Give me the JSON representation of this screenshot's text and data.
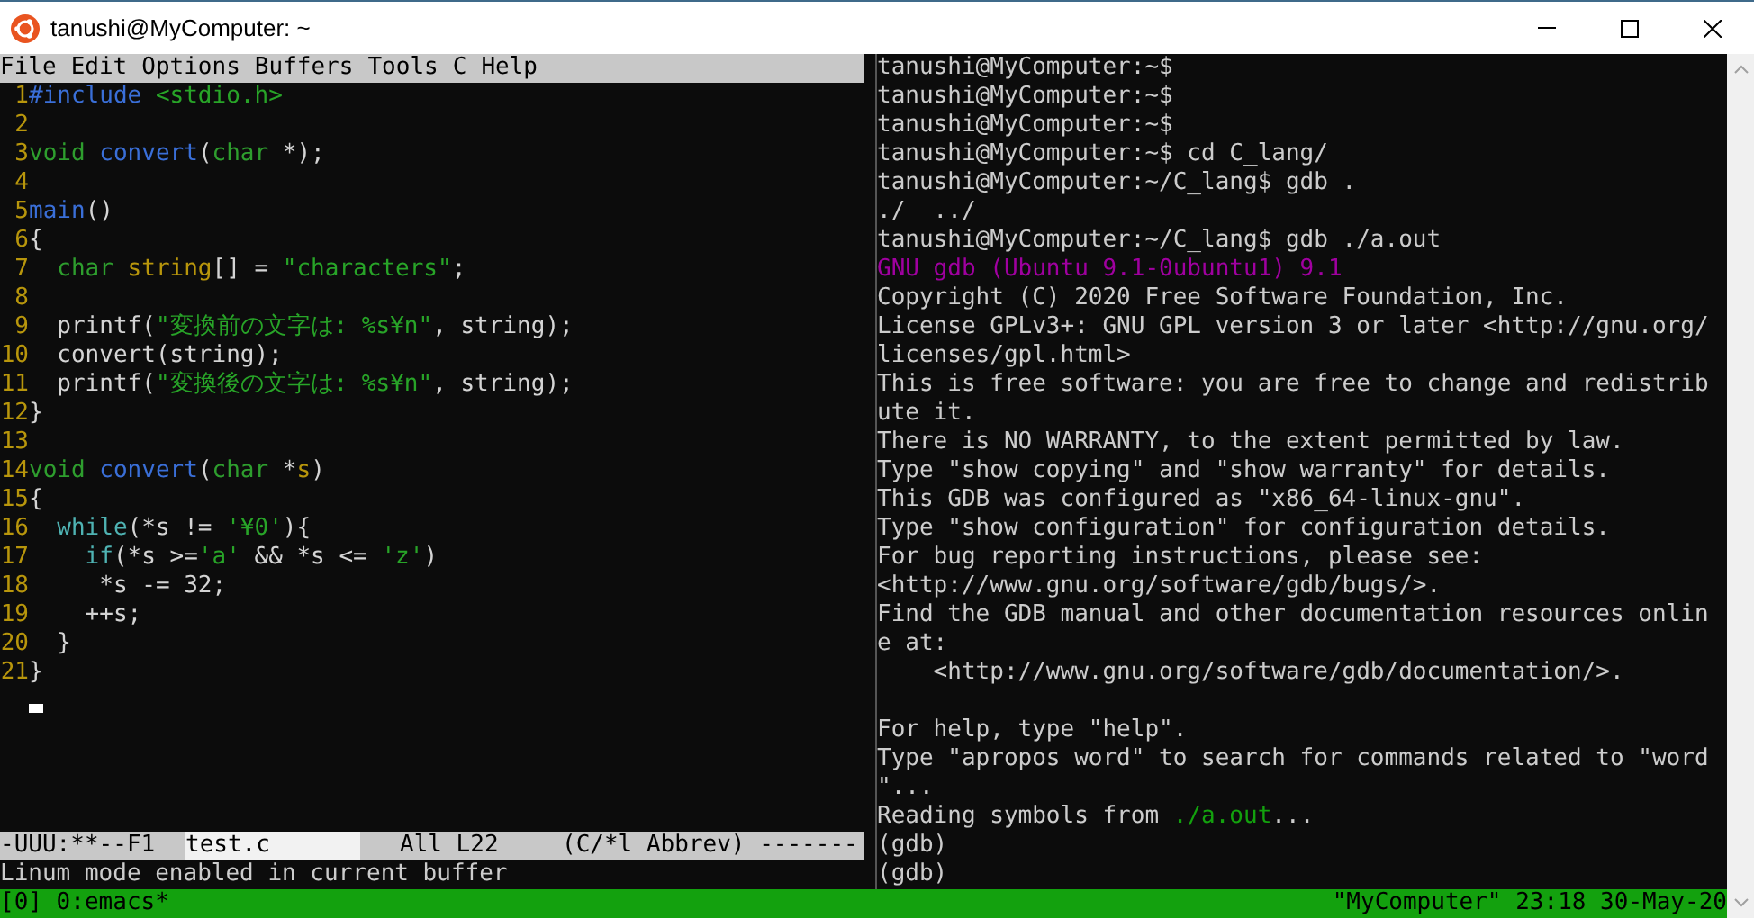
{
  "window": {
    "title": "tanushi@MyComputer: ~"
  },
  "editor": {
    "menu": [
      "File",
      "Edit",
      "Options",
      "Buffers",
      "Tools",
      "C",
      "Help"
    ],
    "lines": [
      {
        "number": "1",
        "segments": [
          {
            "kind": "preprocessor",
            "text": "#include"
          },
          {
            "kind": "string",
            "text": " <stdio.h>"
          }
        ]
      },
      {
        "number": "2"
      },
      {
        "number": "3",
        "segments": [
          {
            "kind": "type",
            "text": "void"
          },
          {
            "kind": "function",
            "text": " convert"
          },
          {
            "kind": "plain",
            "text": "("
          },
          {
            "kind": "type",
            "text": "char"
          },
          {
            "kind": "plain",
            "text": " *);"
          }
        ]
      },
      {
        "number": "4"
      },
      {
        "number": "5",
        "segments": [
          {
            "kind": "function",
            "text": "main"
          },
          {
            "kind": "plain",
            "text": "()"
          }
        ]
      },
      {
        "number": "6",
        "segments": [
          {
            "kind": "plain",
            "text": "{"
          }
        ]
      },
      {
        "number": "7",
        "segments": [
          {
            "kind": "type",
            "text": "  char"
          },
          {
            "kind": "variable",
            "text": " string"
          },
          {
            "kind": "plain",
            "text": "[] = "
          },
          {
            "kind": "string",
            "text": "\"characters\""
          },
          {
            "kind": "plain",
            "text": ";"
          }
        ]
      },
      {
        "number": "8"
      },
      {
        "number": "9",
        "segments": [
          {
            "kind": "plain",
            "text": "  printf("
          },
          {
            "kind": "string",
            "text": "\"変換前の文字は: %s¥n\""
          },
          {
            "kind": "plain",
            "text": ", string);"
          }
        ]
      },
      {
        "number": "10",
        "segments": [
          {
            "kind": "plain",
            "text": "  convert(string);"
          }
        ]
      },
      {
        "number": "11",
        "segments": [
          {
            "kind": "plain",
            "text": "  printf("
          },
          {
            "kind": "string",
            "text": "\"変換後の文字は: %s¥n\""
          },
          {
            "kind": "plain",
            "text": ", string);"
          }
        ]
      },
      {
        "number": "12",
        "segments": [
          {
            "kind": "plain",
            "text": "}"
          }
        ]
      },
      {
        "number": "13"
      },
      {
        "number": "14",
        "segments": [
          {
            "kind": "type",
            "text": "void"
          },
          {
            "kind": "function",
            "text": " convert"
          },
          {
            "kind": "plain",
            "text": "("
          },
          {
            "kind": "type",
            "text": "char"
          },
          {
            "kind": "plain",
            "text": " *"
          },
          {
            "kind": "variable",
            "text": "s"
          },
          {
            "kind": "plain",
            "text": ")"
          }
        ]
      },
      {
        "number": "15",
        "segments": [
          {
            "kind": "plain",
            "text": "{"
          }
        ]
      },
      {
        "number": "16",
        "segments": [
          {
            "kind": "keyword",
            "text": "  while"
          },
          {
            "kind": "plain",
            "text": "(*s != "
          },
          {
            "kind": "string",
            "text": "'¥0'"
          },
          {
            "kind": "plain",
            "text": "){"
          }
        ]
      },
      {
        "number": "17",
        "segments": [
          {
            "kind": "keyword",
            "text": "    if"
          },
          {
            "kind": "plain",
            "text": "(*s >="
          },
          {
            "kind": "string",
            "text": "'a'"
          },
          {
            "kind": "plain",
            "text": " && *s <= "
          },
          {
            "kind": "string",
            "text": "'z'"
          },
          {
            "kind": "plain",
            "text": ")"
          }
        ]
      },
      {
        "number": "18",
        "segments": [
          {
            "kind": "plain",
            "text": "     *s -= 32;"
          }
        ]
      },
      {
        "number": "19",
        "segments": [
          {
            "kind": "plain",
            "text": "    ++s;"
          }
        ]
      },
      {
        "number": "20",
        "segments": [
          {
            "kind": "plain",
            "text": "  }"
          }
        ]
      },
      {
        "number": "21",
        "segments": [
          {
            "kind": "plain",
            "text": "}"
          }
        ]
      }
    ],
    "mode_line": {
      "status": "-UUU:**--F1",
      "buffer": "test.c",
      "position": "All L22",
      "modes": "(C/*l Abbrev) -------"
    },
    "echo_area": "Linum mode enabled in current buffer"
  },
  "terminal": {
    "lines": [
      {
        "segments": [
          {
            "kind": "plain",
            "text": "tanushi@MyComputer:~$"
          }
        ]
      },
      {
        "segments": [
          {
            "kind": "plain",
            "text": "tanushi@MyComputer:~$"
          }
        ]
      },
      {
        "segments": [
          {
            "kind": "plain",
            "text": "tanushi@MyComputer:~$"
          }
        ]
      },
      {
        "segments": [
          {
            "kind": "plain",
            "text": "tanushi@MyComputer:~$ cd C_lang/"
          }
        ]
      },
      {
        "segments": [
          {
            "kind": "plain",
            "text": "tanushi@MyComputer:~/C_lang$ gdb ."
          }
        ]
      },
      {
        "segments": [
          {
            "kind": "plain",
            "text": "./  ../"
          }
        ]
      },
      {
        "segments": [
          {
            "kind": "plain",
            "text": "tanushi@MyComputer:~/C_lang$ gdb ./a.out"
          }
        ]
      },
      {
        "segments": [
          {
            "kind": "banner",
            "text": "GNU gdb (Ubuntu 9.1-0ubuntu1) 9.1"
          }
        ]
      },
      {
        "segments": [
          {
            "kind": "plain",
            "text": "Copyright (C) 2020 Free Software Foundation, Inc."
          }
        ]
      },
      {
        "segments": [
          {
            "kind": "plain",
            "text": "License GPLv3+: GNU GPL version 3 or later <http://gnu.org/"
          }
        ]
      },
      {
        "segments": [
          {
            "kind": "plain",
            "text": "licenses/gpl.html>"
          }
        ]
      },
      {
        "segments": [
          {
            "kind": "plain",
            "text": "This is free software: you are free to change and redistrib"
          }
        ]
      },
      {
        "segments": [
          {
            "kind": "plain",
            "text": "ute it."
          }
        ]
      },
      {
        "segments": [
          {
            "kind": "plain",
            "text": "There is NO WARRANTY, to the extent permitted by law."
          }
        ]
      },
      {
        "segments": [
          {
            "kind": "plain",
            "text": "Type \"show copying\" and \"show warranty\" for details."
          }
        ]
      },
      {
        "segments": [
          {
            "kind": "plain",
            "text": "This GDB was configured as \"x86_64-linux-gnu\"."
          }
        ]
      },
      {
        "segments": [
          {
            "kind": "plain",
            "text": "Type \"show configuration\" for configuration details."
          }
        ]
      },
      {
        "segments": [
          {
            "kind": "plain",
            "text": "For bug reporting instructions, please see:"
          }
        ]
      },
      {
        "segments": [
          {
            "kind": "plain",
            "text": "<http://www.gnu.org/software/gdb/bugs/>."
          }
        ]
      },
      {
        "segments": [
          {
            "kind": "plain",
            "text": "Find the GDB manual and other documentation resources onlin"
          }
        ]
      },
      {
        "segments": [
          {
            "kind": "plain",
            "text": "e at:"
          }
        ]
      },
      {
        "segments": [
          {
            "kind": "plain",
            "text": "    <http://www.gnu.org/software/gdb/documentation/>."
          }
        ]
      },
      {
        "blank_before": true,
        "segments": [
          {
            "kind": "plain",
            "text": "For help, type \"help\"."
          }
        ]
      },
      {
        "segments": [
          {
            "kind": "plain",
            "text": "Type \"apropos word\" to search for commands related to \"word"
          }
        ]
      },
      {
        "segments": [
          {
            "kind": "plain",
            "text": "\"..."
          }
        ]
      },
      {
        "segments": [
          {
            "kind": "plain",
            "text": "Reading symbols from "
          },
          {
            "kind": "path",
            "text": "./a.out"
          },
          {
            "kind": "plain",
            "text": "..."
          }
        ]
      },
      {
        "segments": [
          {
            "kind": "plain",
            "text": "(gdb)"
          }
        ]
      },
      {
        "segments": [
          {
            "kind": "plain",
            "text": "(gdb)"
          }
        ]
      }
    ]
  },
  "tmux_status": {
    "window_list": "[0] 0:emacs*",
    "host_clock": "\"MyComputer\" 23:18 30-May-20"
  }
}
